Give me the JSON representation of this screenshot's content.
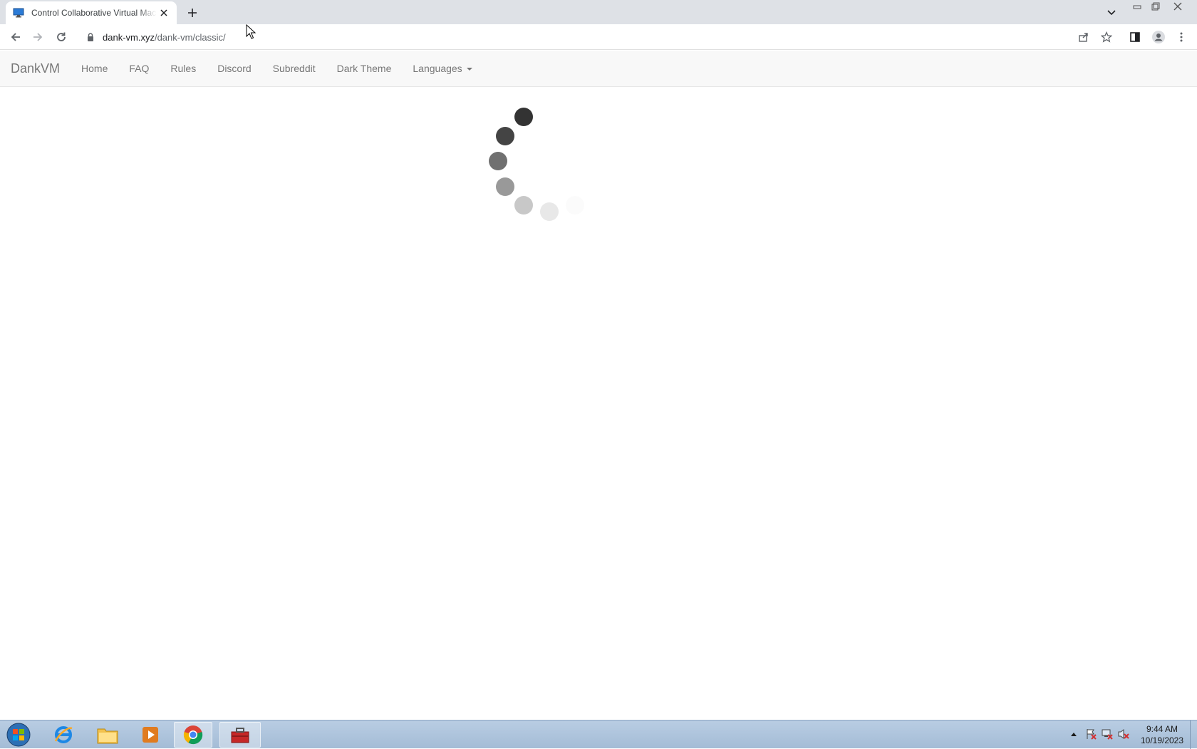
{
  "browser": {
    "tab_title": "Control Collaborative Virtual Machines",
    "url_host": "dank-vm.xyz",
    "url_path": "/dank-vm/classic/"
  },
  "navbar": {
    "brand": "DankVM",
    "links": [
      "Home",
      "FAQ",
      "Rules",
      "Discord",
      "Subreddit",
      "Dark Theme"
    ],
    "languages_label": "Languages"
  },
  "taskbar": {
    "time": "9:44 AM",
    "date": "10/19/2023"
  },
  "colors": {
    "navbar_bg": "#f8f8f8",
    "navbar_text": "#777777",
    "tabstrip_bg": "#dee1e6",
    "taskbar_bg": "#a4bcd6"
  },
  "icons": {
    "tab": [
      "monitor-icon",
      "close-icon",
      "plus-icon",
      "chevron-down-icon"
    ],
    "toolbar": [
      "back-icon",
      "forward-icon",
      "reload-icon",
      "lock-icon",
      "share-icon",
      "star-icon",
      "sidepanel-icon",
      "profile-icon",
      "more-icon"
    ],
    "taskbar": [
      "windows-start-icon",
      "internet-explorer-icon",
      "file-explorer-icon",
      "media-player-icon",
      "chrome-icon",
      "toolbox-icon"
    ]
  }
}
